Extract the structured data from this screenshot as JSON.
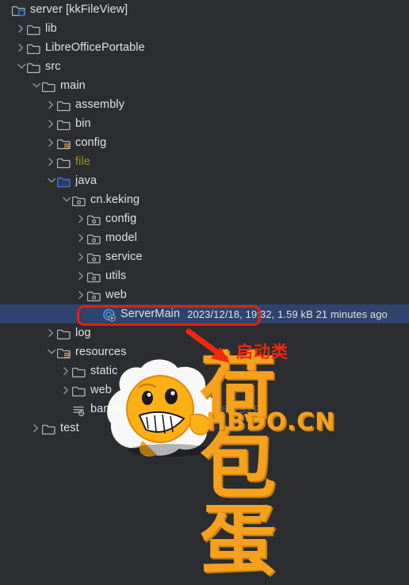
{
  "window": {
    "title": "server [kkFileView]",
    "icon": "module-folder-icon",
    "background_color": "#2b2d30",
    "selection_color": "#2e436e",
    "text_color": "#dfe1e5"
  },
  "tree": {
    "name": "project-tree",
    "rows": [
      {
        "label": "server [kkFileView]",
        "depth": 0,
        "twisty": "none",
        "icon": "module-folder-icon",
        "selected": false,
        "label_color": "default"
      },
      {
        "label": "lib",
        "depth": 1,
        "twisty": "collapsed",
        "icon": "folder-icon",
        "selected": false,
        "label_color": "default"
      },
      {
        "label": "LibreOfficePortable",
        "depth": 1,
        "twisty": "collapsed",
        "icon": "folder-icon",
        "selected": false,
        "label_color": "default"
      },
      {
        "label": "src",
        "depth": 1,
        "twisty": "expanded",
        "icon": "folder-icon",
        "selected": false,
        "label_color": "default"
      },
      {
        "label": "main",
        "depth": 2,
        "twisty": "expanded",
        "icon": "folder-icon",
        "selected": false,
        "label_color": "default"
      },
      {
        "label": "assembly",
        "depth": 3,
        "twisty": "collapsed",
        "icon": "folder-icon",
        "selected": false,
        "label_color": "default"
      },
      {
        "label": "bin",
        "depth": 3,
        "twisty": "collapsed",
        "icon": "folder-icon",
        "selected": false,
        "label_color": "default"
      },
      {
        "label": "config",
        "depth": 3,
        "twisty": "collapsed",
        "icon": "resources-folder-icon",
        "selected": false,
        "label_color": "default"
      },
      {
        "label": "file",
        "depth": 3,
        "twisty": "collapsed",
        "icon": "folder-icon",
        "selected": false,
        "label_color": "olive"
      },
      {
        "label": "java",
        "depth": 3,
        "twisty": "expanded",
        "icon": "source-folder-icon",
        "selected": false,
        "label_color": "default"
      },
      {
        "label": "cn.keking",
        "depth": 4,
        "twisty": "expanded",
        "icon": "package-icon",
        "selected": false,
        "label_color": "default"
      },
      {
        "label": "config",
        "depth": 5,
        "twisty": "collapsed",
        "icon": "package-icon",
        "selected": false,
        "label_color": "default"
      },
      {
        "label": "model",
        "depth": 5,
        "twisty": "collapsed",
        "icon": "package-icon",
        "selected": false,
        "label_color": "default"
      },
      {
        "label": "service",
        "depth": 5,
        "twisty": "collapsed",
        "icon": "package-icon",
        "selected": false,
        "label_color": "default"
      },
      {
        "label": "utils",
        "depth": 5,
        "twisty": "collapsed",
        "icon": "package-icon",
        "selected": false,
        "label_color": "default"
      },
      {
        "label": "web",
        "depth": 5,
        "twisty": "collapsed",
        "icon": "package-icon",
        "selected": false,
        "label_color": "default"
      },
      {
        "label": "ServerMain",
        "depth": 6,
        "twisty": "none",
        "icon": "java-class-run-icon",
        "selected": true,
        "label_color": "default",
        "meta": "2023/12/18, 19:32, 1.59 kB 21 minutes ago"
      },
      {
        "label": "log",
        "depth": 3,
        "twisty": "collapsed",
        "icon": "folder-icon",
        "selected": false,
        "label_color": "default"
      },
      {
        "label": "resources",
        "depth": 3,
        "twisty": "expanded",
        "icon": "resources-folder-icon",
        "selected": false,
        "label_color": "default"
      },
      {
        "label": "static",
        "depth": 4,
        "twisty": "collapsed",
        "icon": "folder-icon",
        "selected": false,
        "label_color": "default"
      },
      {
        "label": "web",
        "depth": 4,
        "twisty": "collapsed",
        "icon": "folder-icon",
        "selected": false,
        "label_color": "default"
      },
      {
        "label": "banner.txt",
        "depth": 4,
        "twisty": "none",
        "icon": "text-file-icon",
        "selected": false,
        "label_color": "default",
        "meta": "2023/1/19, 09:28, 755 B",
        "meta_dim": true
      },
      {
        "label": "test",
        "depth": 2,
        "twisty": "collapsed",
        "icon": "folder-icon",
        "selected": false,
        "label_color": "default"
      }
    ]
  },
  "annotations": {
    "highlight_box": {
      "name": "servermain-red-highlight",
      "color": "#f01b0e"
    },
    "arrow": {
      "name": "red-arrow",
      "color": "#f0280f"
    },
    "callout_text": {
      "text": "启动类",
      "color": "#f0280f"
    }
  },
  "watermark": {
    "main_text": "荷包蛋",
    "sub_text": "HBDO.CN",
    "color": "#f5a11e"
  }
}
